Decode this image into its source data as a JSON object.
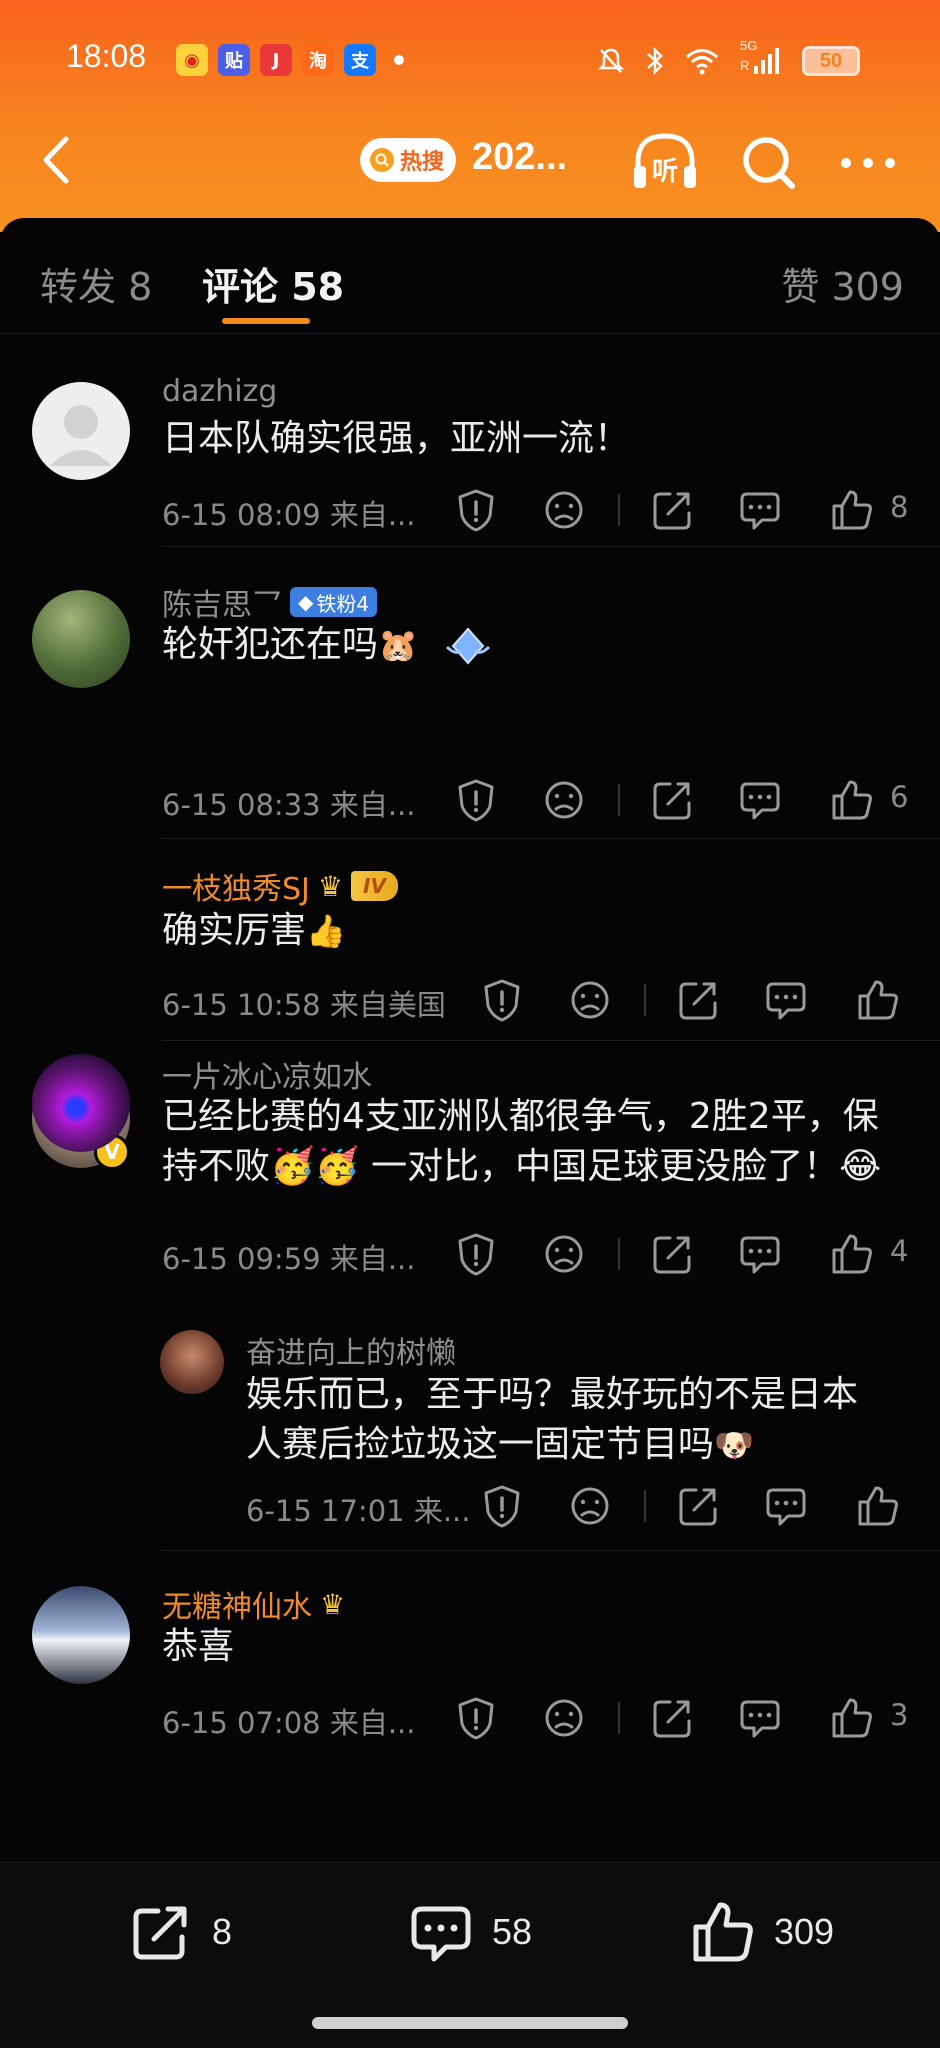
{
  "status_bar": {
    "time": "18:08",
    "network": "5G",
    "roaming": "R",
    "battery": "50"
  },
  "nav": {
    "hot_badge": "热搜",
    "title": "202..."
  },
  "tabs": {
    "repost": "转发 8",
    "comment": "评论 58",
    "like": "赞 309"
  },
  "comments": [
    {
      "name": "dazhizg",
      "text": "日本队确实很强，亚洲一流！",
      "meta": "6-15 08:09  来自...",
      "likes": "8"
    },
    {
      "name": "陈吉思乛",
      "badge": "铁粉4",
      "text": "轮奸犯还在吗",
      "meta": "6-15 08:33  来自...",
      "likes": "6"
    },
    {
      "name": "一枝独秀SJ",
      "badge": "IV",
      "text": "确实厉害",
      "meta": "6-15 10:58  来自美国",
      "likes": ""
    },
    {
      "name": "一片冰心凉如水",
      "text": "已经比赛的4支亚洲队都很争气，2胜2平，保持不败🥳🥳 一对比，中国足球更没脸了！😂",
      "meta": "6-15 09:59  来自...",
      "likes": "4"
    },
    {
      "name": "奋进向上的树懒",
      "text": "娱乐而已，至于吗？最好玩的不是日本人赛后捡垃圾这一固定节目吗",
      "meta": "6-15 17:01  来...",
      "likes": ""
    },
    {
      "name": "无糖神仙水",
      "text": "恭喜",
      "meta": "6-15 07:08  来自...",
      "likes": "3"
    }
  ],
  "bottom_bar": {
    "repost_count": "8",
    "comment_count": "58",
    "like_count": "309"
  },
  "colors": {
    "accent": "#f7641c",
    "name_orange": "#f08a2a",
    "tab_indicator": "#f28a1c"
  }
}
